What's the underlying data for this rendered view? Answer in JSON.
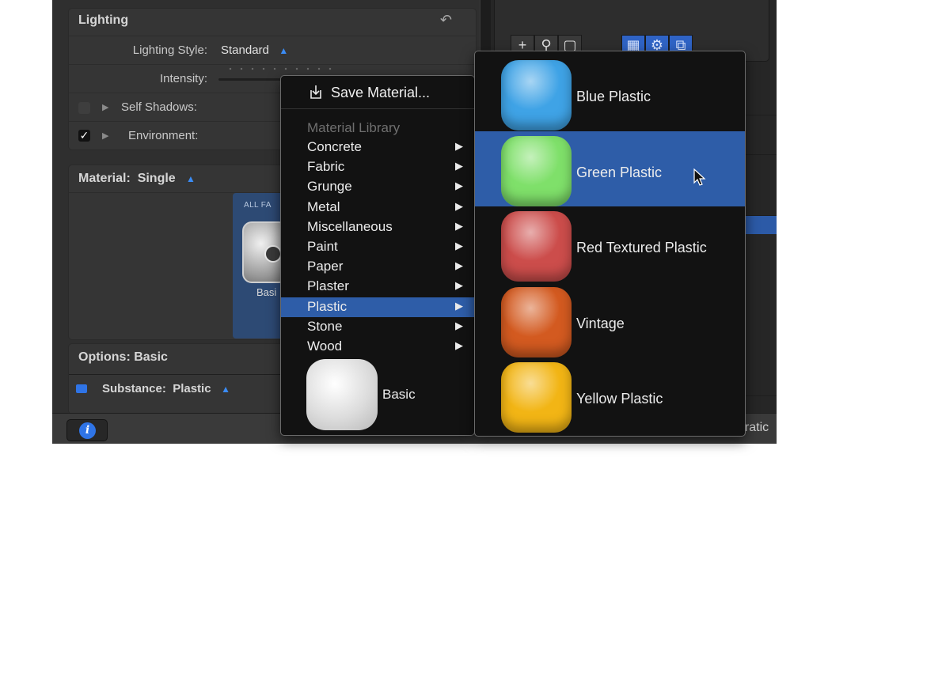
{
  "inspector": {
    "lighting": {
      "title": "Lighting",
      "style_label": "Lighting Style:",
      "style_value": "Standard",
      "intensity_label": "Intensity:",
      "self_shadows_label": "Self Shadows:",
      "self_shadows_checked": false,
      "environment_label": "Environment:",
      "environment_checked": true
    },
    "material": {
      "label": "Material:",
      "value": "Single",
      "tile_header": "ALL FA",
      "tile_caption": "Basi"
    },
    "options": {
      "title": "Options: Basic",
      "substance_label": "Substance:",
      "substance_value": "Plastic"
    }
  },
  "statusbar": {
    "partial_text": "uratic"
  },
  "menu": {
    "save_label": "Save Material...",
    "library_header": "Material Library",
    "categories": [
      "Concrete",
      "Fabric",
      "Grunge",
      "Metal",
      "Miscellaneous",
      "Paint",
      "Paper",
      "Plaster",
      "Plastic",
      "Stone",
      "Wood"
    ],
    "active_category": "Plastic",
    "basic_label": "Basic"
  },
  "submenu": {
    "items": [
      {
        "label": "Blue Plastic",
        "color": "#3fa3e6"
      },
      {
        "label": "Green Plastic",
        "color": "#7fe06a"
      },
      {
        "label": "Red Textured Plastic",
        "color": "#cc4d4b"
      },
      {
        "label": "Vintage",
        "color": "#d35a20"
      },
      {
        "label": "Yellow Plastic",
        "color": "#f2b515"
      }
    ],
    "active_item": "Green Plastic"
  },
  "colors": {
    "selection": "#2e5da8",
    "accent": "#3b8cf5"
  }
}
